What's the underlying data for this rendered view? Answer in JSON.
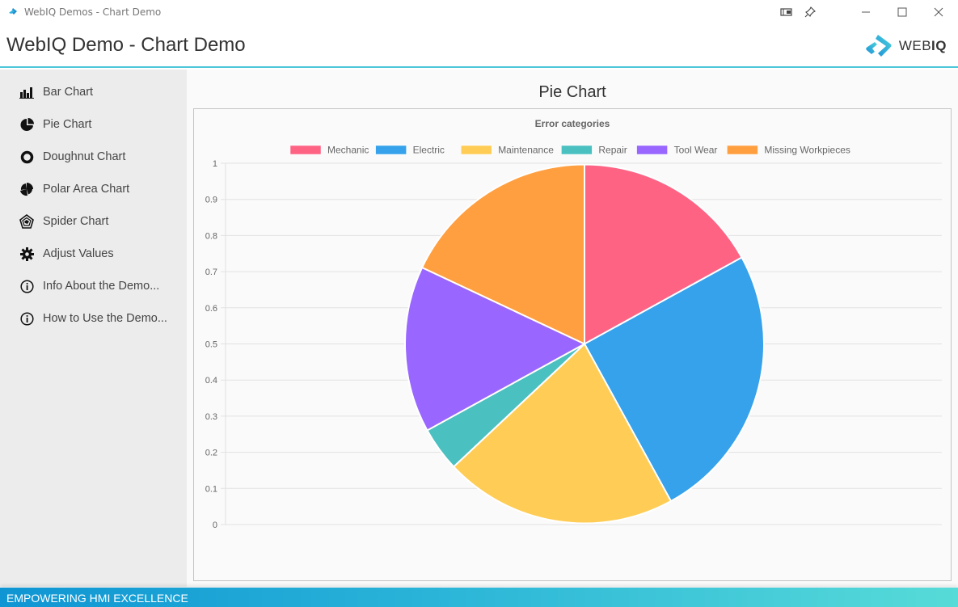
{
  "window": {
    "title": "WebIQ Demos - Chart Demo",
    "controls": [
      "cast-icon",
      "pin-icon",
      "minimize",
      "maximize",
      "close"
    ]
  },
  "header": {
    "title": "WebIQ Demo - Chart Demo",
    "logo_text_light": "WEB",
    "logo_text_bold": "IQ"
  },
  "sidebar": {
    "items": [
      {
        "label": "Bar Chart",
        "icon": "bar-chart-icon"
      },
      {
        "label": "Pie Chart",
        "icon": "pie-chart-icon"
      },
      {
        "label": "Doughnut Chart",
        "icon": "doughnut-chart-icon"
      },
      {
        "label": "Polar Area Chart",
        "icon": "polar-area-chart-icon"
      },
      {
        "label": "Spider Chart",
        "icon": "spider-chart-icon"
      },
      {
        "label": "Adjust Values",
        "icon": "gear-icon"
      },
      {
        "label": "Info About the Demo...",
        "icon": "info-icon"
      },
      {
        "label": "How to Use the Demo...",
        "icon": "info-icon"
      }
    ]
  },
  "main": {
    "section_title": "Pie Chart"
  },
  "footer": {
    "slogan": "EMPOWERING HMI EXCELLENCE"
  },
  "colors": {
    "accent": "#4cc6d8",
    "sidebar_bg": "#ececec"
  },
  "chart_data": {
    "type": "pie",
    "title": "Error categories",
    "categories": [
      "Mechanic",
      "Electric",
      "Maintenance",
      "Repair",
      "Tool Wear",
      "Missing Workpieces"
    ],
    "values": [
      17,
      25,
      21,
      4,
      15,
      18
    ],
    "colors": [
      "#ff6384",
      "#36a2eb",
      "#ffcd56",
      "#4bc0c0",
      "#9966ff",
      "#ff9f40"
    ],
    "legend_position": "top",
    "yaxis": {
      "ticks": [
        "1",
        "0.9",
        "0.8",
        "0.7",
        "0.6",
        "0.5",
        "0.4",
        "0.3",
        "0.2",
        "0.1",
        "0"
      ],
      "ylim": [
        0,
        1
      ],
      "grid": true
    }
  }
}
